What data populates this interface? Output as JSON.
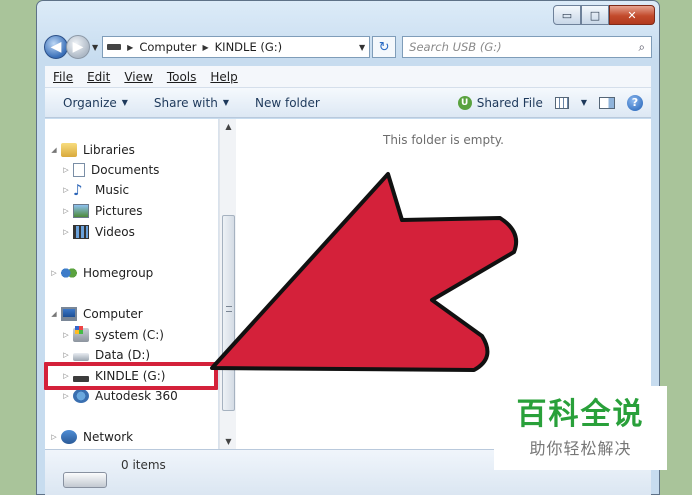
{
  "window": {
    "captions": {
      "minimize": "▭",
      "maximize": "□",
      "close": "✕"
    }
  },
  "address": {
    "back_icon": "back-arrow-icon",
    "crumbs": [
      "Computer",
      "KINDLE (G:)"
    ],
    "refresh_glyph": "↻"
  },
  "search": {
    "placeholder": "Search USB (G:)",
    "icon_glyph": "⌕"
  },
  "menu": {
    "items": [
      "File",
      "Edit",
      "View",
      "Tools",
      "Help"
    ]
  },
  "toolbar": {
    "organize": "Organize",
    "share_with": "Share with",
    "new_folder": "New folder",
    "shared_file": "Shared File",
    "help_glyph": "?"
  },
  "nav": {
    "items": [
      {
        "label": "Libraries",
        "icon": "library-icon",
        "expanded": true
      },
      {
        "label": "Documents",
        "icon": "documents-icon"
      },
      {
        "label": "Music",
        "icon": "music-icon"
      },
      {
        "label": "Pictures",
        "icon": "pictures-icon"
      },
      {
        "label": "Videos",
        "icon": "videos-icon"
      },
      {
        "label": "Homegroup",
        "icon": "homegroup-icon"
      },
      {
        "label": "Computer",
        "icon": "computer-icon",
        "expanded": true
      },
      {
        "label": "system (C:)",
        "icon": "system-drive-icon"
      },
      {
        "label": "Data (D:)",
        "icon": "drive-icon"
      },
      {
        "label": "KINDLE (G:)",
        "icon": "kindle-drive-icon",
        "selected": true
      },
      {
        "label": "Autodesk 360",
        "icon": "autodesk-icon"
      },
      {
        "label": "Network",
        "icon": "network-icon"
      }
    ]
  },
  "content": {
    "empty_message": "This folder is empty."
  },
  "details": {
    "count": "0 items"
  },
  "annotation": {
    "highlight_color": "#d4213a",
    "arrow_color": "#d4213a"
  },
  "watermark": {
    "title": "百科全说",
    "subtitle": "助你轻松解决"
  }
}
